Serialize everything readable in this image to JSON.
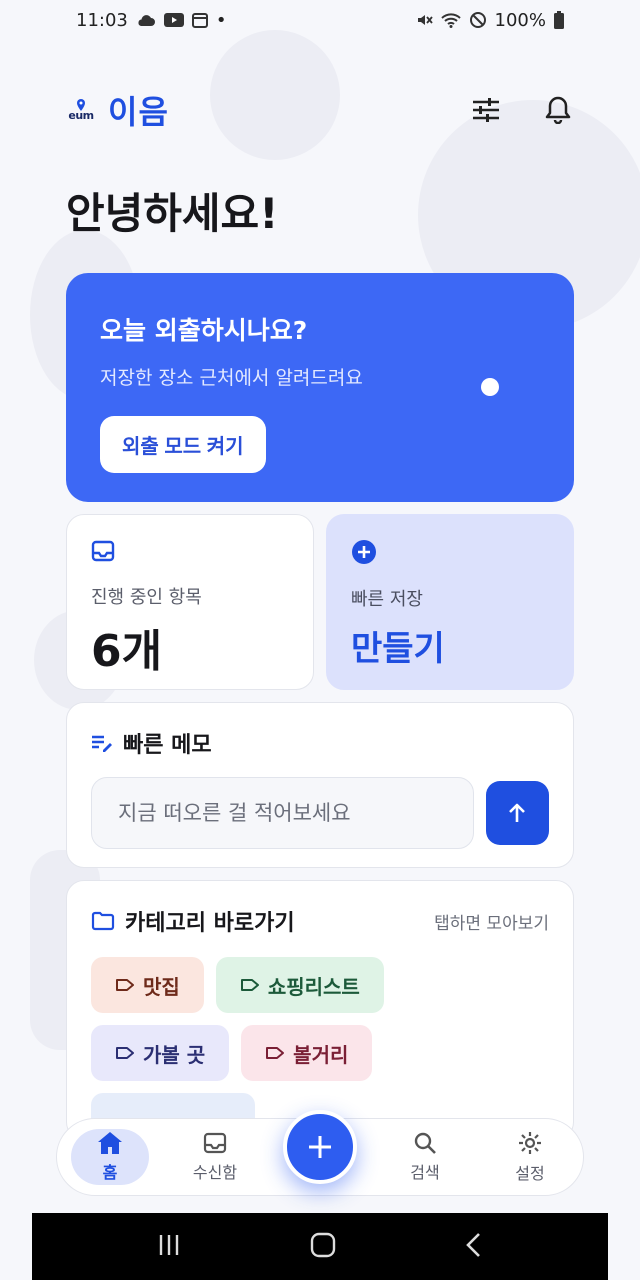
{
  "status_bar": {
    "time": "11:03",
    "battery": "100%"
  },
  "header": {
    "logo_small": "eum",
    "logo_text": "이음",
    "filter_icon": "tune-icon",
    "bell_icon": "bell-icon"
  },
  "greeting": "안녕하세요!",
  "hero": {
    "title": "오늘 외출하시나요?",
    "subtitle": "저장한 장소 근처에서 알려드려요",
    "button_label": "외출 모드 켜기"
  },
  "progress_card": {
    "label": "진행 중인 항목",
    "value": "6개"
  },
  "quick_save_card": {
    "label": "빠른 저장",
    "value": "만들기"
  },
  "memo": {
    "title": "빠른 메모",
    "placeholder": "지금 떠오른 걸 적어보세요"
  },
  "categories": {
    "title": "카테고리 바로가기",
    "hint": "탭하면 모아보기",
    "items": [
      {
        "label": "맛집",
        "bg": "#fbe6df",
        "color": "#6e2a1a"
      },
      {
        "label": "쇼핑리스트",
        "bg": "#dff3e6",
        "color": "#1c5a3a"
      },
      {
        "label": "가볼 곳",
        "bg": "#e8e8fb",
        "color": "#2b2f73"
      },
      {
        "label": "볼거리",
        "bg": "#fbe5ea",
        "color": "#7a1f35"
      }
    ]
  },
  "bottom_nav": {
    "home": "홈",
    "inbox": "수신함",
    "search": "검색",
    "settings": "설정"
  },
  "colors": {
    "primary": "#1f4fe0",
    "hero": "#3d68f5",
    "quick_card": "#dce1fc"
  }
}
